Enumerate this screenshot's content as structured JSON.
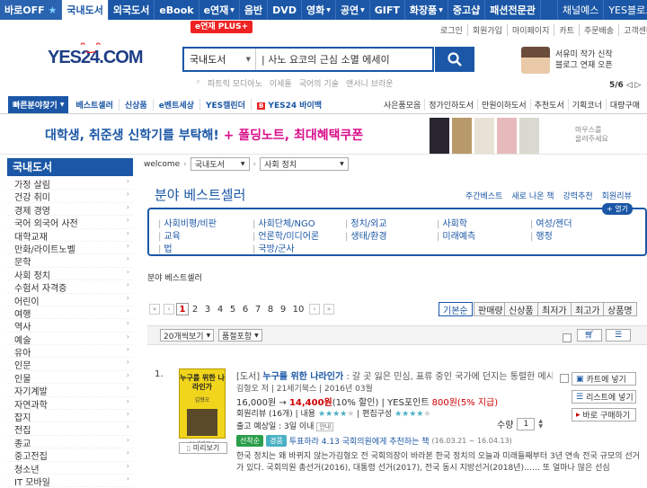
{
  "topnav": {
    "items": [
      {
        "label": "바로OFF",
        "marker": "★"
      },
      {
        "label": "국내도서"
      },
      {
        "label": "외국도서"
      },
      {
        "label": "eBook"
      },
      {
        "label": "e연재"
      },
      {
        "label": "음반"
      },
      {
        "label": "DVD"
      },
      {
        "label": "영화"
      },
      {
        "label": "공연"
      },
      {
        "label": "GIFT"
      },
      {
        "label": "화장품"
      },
      {
        "label": "중고샵"
      },
      {
        "label": "패션전문관"
      },
      {
        "label": "채널예스"
      },
      {
        "label": "YES블로그"
      }
    ],
    "plus_badge": "e연재 PLUS+"
  },
  "util_links": [
    "로그인",
    "회원가입",
    "마이페이지",
    "카트",
    "주문배송",
    "고객센터"
  ],
  "logo": {
    "text": "YES24.COM"
  },
  "search": {
    "category": "국내도서",
    "value": "| 사노 요코의 근심 소멸 에세이"
  },
  "keywords": [
    "파트릭 모디아노",
    "이세돌",
    "국어의 기술",
    "앤서니 브라운"
  ],
  "promo": {
    "line1": "서유미 작가 신작",
    "line2": "블로그 연재 오픈",
    "pager": "5/6"
  },
  "catbar": {
    "quick": "빠른분야찾기",
    "main_items": [
      "베스트셀러",
      "신상품",
      "e벤트세상",
      "YES캘린더",
      "YES24 바이백"
    ],
    "right_items": [
      "사은품모음",
      "정가인하도서",
      "만원이하도서",
      "추천도서",
      "기획코너",
      "대량구매"
    ]
  },
  "banner": {
    "text1": "대학생, 취준생 신학기를 부탁해!",
    "text2": " + 폴딩노트, 최대혜택쿠폰",
    "side1": "마우스를",
    "side2": "올려주세요"
  },
  "sidebar": {
    "title": "국내도서",
    "items": [
      "가정 살림",
      "건강 취미",
      "경제 경영",
      "국어 외국어 사전",
      "대학교재",
      "만화/라이트노벨",
      "문학",
      "사회 정치",
      "수험서 자격증",
      "어린이",
      "여행",
      "역사",
      "예술",
      "유아",
      "인문",
      "인물",
      "자기계발",
      "자연과학",
      "잡지",
      "전집",
      "종교",
      "중고전집",
      "청소년",
      "IT 모바일"
    ]
  },
  "crumb": {
    "home": "welcome",
    "cat1": "국내도서",
    "cat2": "사회 정치"
  },
  "section": {
    "title": "분야 베스트셀러",
    "links": [
      "주간베스트",
      "새로 나온 책",
      "강력추천",
      "회원리뷰"
    ],
    "more": "+ 열기",
    "subcats": [
      "사회비평/비판",
      "사회단체/NGO",
      "정치/외교",
      "사회학",
      "여성/젠더",
      "교육",
      "언론학/미디어론",
      "생태/환경",
      "미래예측",
      "행정",
      "법",
      "국방/군사"
    ],
    "subtitle": "분야 베스트셀러"
  },
  "pagination": {
    "pages": [
      "1",
      "2",
      "3",
      "4",
      "5",
      "6",
      "7",
      "8",
      "9",
      "10"
    ],
    "current": "1"
  },
  "sort": [
    "기본순",
    "판매량",
    "신상품",
    "최저가",
    "최고가",
    "상품명"
  ],
  "options": {
    "view": "20개씩보기",
    "filter": "품절포함"
  },
  "book": {
    "rank": "1.",
    "cover_title": "누구를 위한 나라인가",
    "cover_sub": "김형오",
    "cover_footer": "21세기북스",
    "category": "[도서] ",
    "title": "누구를 위한 나라인가",
    "subtitle": " : 갈 곳 잃은 민심, 표류 중인 국가에 던지는 통렬한 메시지",
    "author": "김형오 저 | 21세기북스 | 2016년 03월",
    "price_list": "16,000원 → ",
    "price_sale": "14,400원",
    "price_rest": "(10% 할인) | YES포인트 ",
    "points": "800원(5% 지급)",
    "review_label": "회원리뷰 (16개) | 내용",
    "review_label2": "| 편집구성",
    "ship": "출고 예상일 : 3일 이내",
    "ship_badge": "안내",
    "qty_label": "수량",
    "qty": "1",
    "tag1": "선착순",
    "tag2": "경품",
    "tag_text": "투표하라 4.13 국회의원에게 추천하는 책",
    "tag_date": "(16.03.21 ~ 16.04.13)",
    "summary": "한국 정치는 왜 바뀌지 않는가김형오 전 국회의장이 바라본 한국 정치의 오늘과 미래들째부터 3년 연속 전국 규모의 선거가 있다. 국회의원 총선거(2016), 대통령 선거(2017), 전국 동시 지방선거(2018년)…… 또 얼마나 많은 선심",
    "preview": "미리보기",
    "actions": [
      "카트에 넣기",
      "리스트에 넣기",
      "바로 구매하기"
    ]
  },
  "colors": {
    "brand": "#1b57a6",
    "sale": "#cc0000",
    "accent": "#d8108b"
  }
}
